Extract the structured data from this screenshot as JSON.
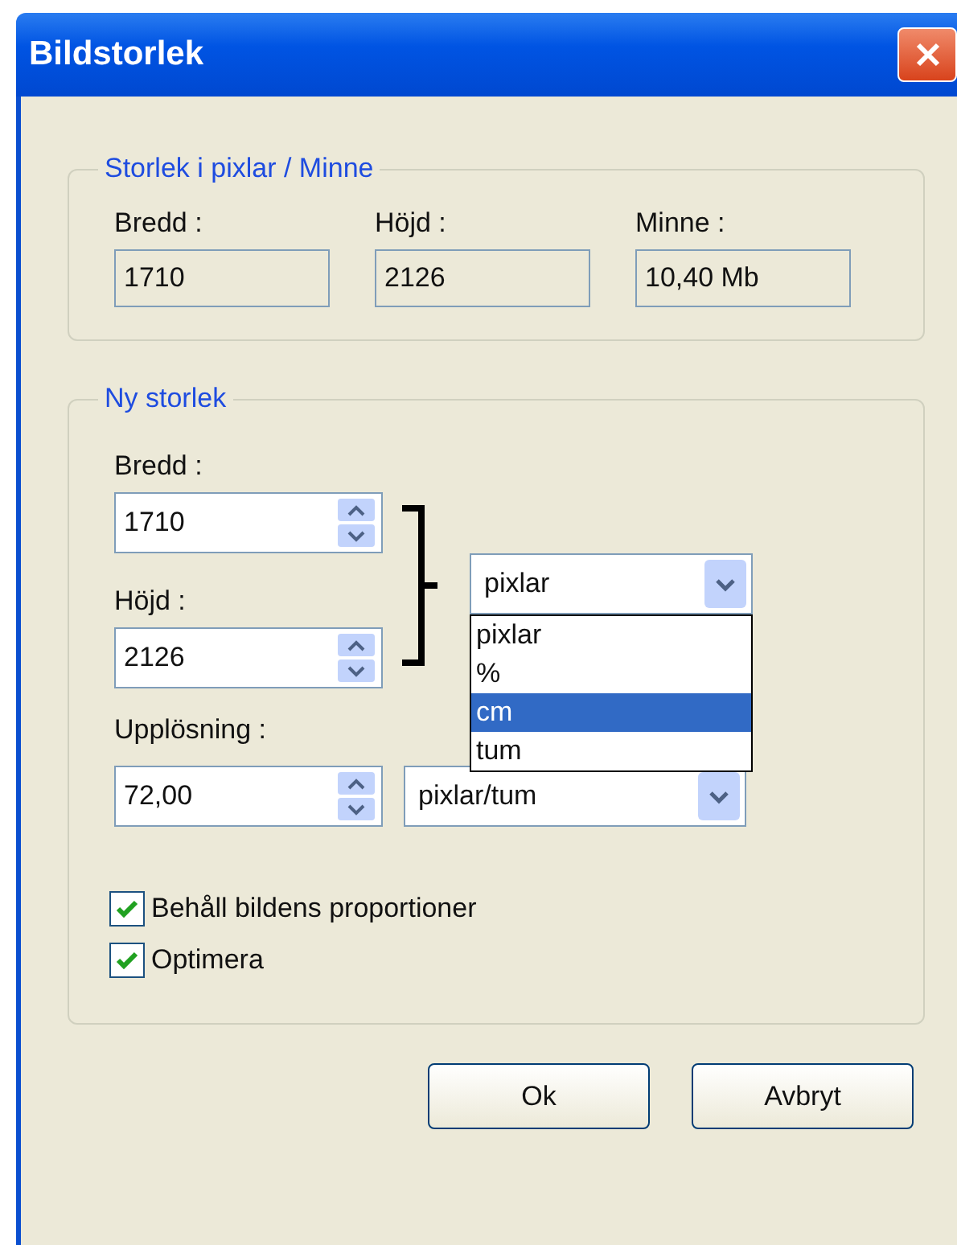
{
  "window": {
    "title": "Bildstorlek"
  },
  "current_size": {
    "title": "Storlek i pixlar / Minne",
    "fields": [
      {
        "label": "Bredd :",
        "value": "1710"
      },
      {
        "label": "Höjd :",
        "value": "2126"
      },
      {
        "label": "Minne :",
        "value": "10,40 Mb"
      }
    ]
  },
  "new_size": {
    "title": "Ny storlek",
    "width": {
      "label": "Bredd :",
      "value": "1710"
    },
    "height": {
      "label": "Höjd :",
      "value": "2126"
    },
    "unit": {
      "value": "pixlar",
      "expanded": true,
      "options": [
        {
          "label": "pixlar",
          "highlighted": false
        },
        {
          "label": "%",
          "highlighted": false
        },
        {
          "label": "cm",
          "highlighted": true
        },
        {
          "label": "tum",
          "highlighted": false
        }
      ]
    },
    "resolution": {
      "label": "Upplösning :",
      "value": "72,00",
      "unit": "pixlar/tum"
    },
    "options": [
      {
        "label": "Behåll bildens proportioner",
        "checked": true
      },
      {
        "label": "Optimera",
        "checked": true
      }
    ]
  },
  "buttons": [
    {
      "label": "Ok"
    },
    {
      "label": "Avbryt"
    }
  ]
}
